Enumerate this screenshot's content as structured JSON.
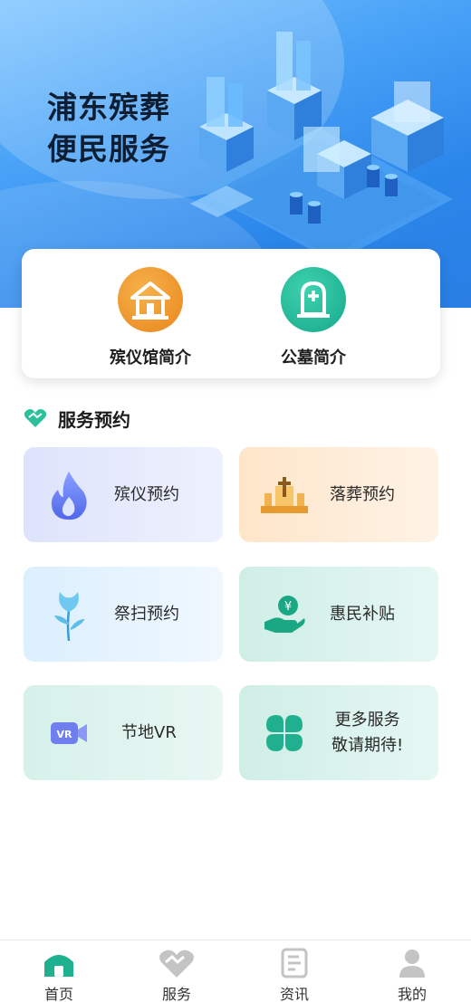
{
  "banner": {
    "title_line1": "浦东殡葬",
    "title_line2": "便民服务"
  },
  "quick_links": [
    {
      "label": "殡仪馆简介",
      "icon": "funeral-home-icon",
      "color": "#ef9a2f"
    },
    {
      "label": "公墓简介",
      "icon": "tombstone-icon",
      "color": "#19b08f"
    }
  ],
  "section": {
    "title": "服务预约",
    "icon": "heart-handshake-icon"
  },
  "services": [
    {
      "label": "殡仪预约",
      "icon": "flame-icon"
    },
    {
      "label": "落葬预约",
      "icon": "burial-cross-icon"
    },
    {
      "label": "祭扫预约",
      "icon": "flower-icon"
    },
    {
      "label": "惠民补贴",
      "icon": "yen-hand-icon"
    },
    {
      "label": "节地VR",
      "icon": "vr-camera-icon"
    },
    {
      "label_line1": "更多服务",
      "label_line2": "敬请期待!",
      "icon": "clover-icon"
    }
  ],
  "bottom_nav": [
    {
      "label": "首页",
      "icon": "home-icon",
      "active": true
    },
    {
      "label": "服务",
      "icon": "handshake-icon",
      "active": false
    },
    {
      "label": "资讯",
      "icon": "document-icon",
      "active": false
    },
    {
      "label": "我的",
      "icon": "user-icon",
      "active": false
    }
  ],
  "colors": {
    "accent": "#2bbf9a",
    "banner": "#3d97ef"
  }
}
